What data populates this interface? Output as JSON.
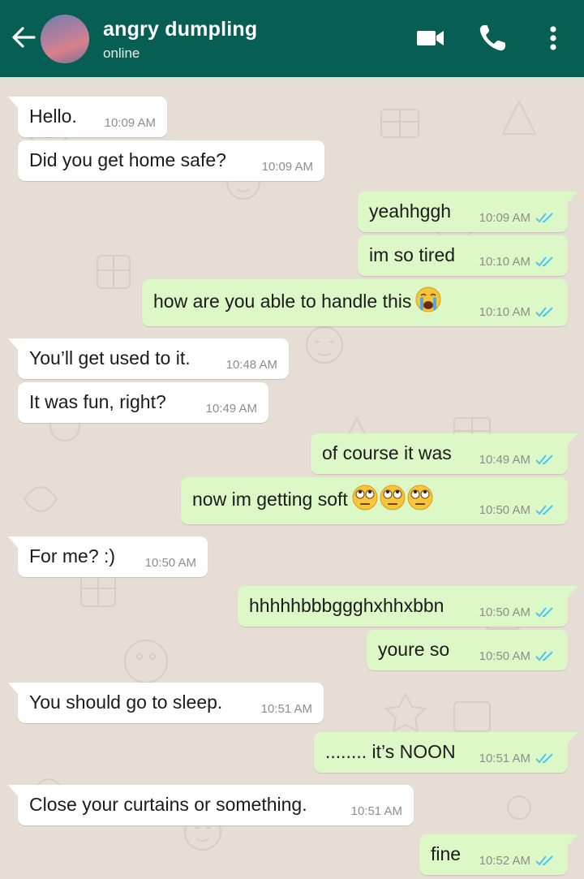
{
  "header": {
    "contact_name": "angry dumpling",
    "status": "online",
    "icons": [
      "back-arrow-icon",
      "avatar",
      "video-call-icon",
      "phone-call-icon",
      "more-options-icon"
    ]
  },
  "colors": {
    "header_bg": "#075e54",
    "chat_bg": "#e6ddd4",
    "incoming_bubble": "#ffffff",
    "outgoing_bubble": "#dcf8c6",
    "read_ticks": "#4fc3f7"
  },
  "messages": [
    {
      "dir": "in",
      "text": "Hello.",
      "time": "10:09 AM"
    },
    {
      "dir": "in",
      "text": "Did you get home safe?",
      "time": "10:09 AM"
    },
    {
      "dir": "out",
      "text": "yeahhggh",
      "time": "10:09 AM",
      "read": true
    },
    {
      "dir": "out",
      "text": "im so tired",
      "time": "10:10 AM",
      "read": true
    },
    {
      "dir": "out",
      "text": "how are you able to handle this",
      "time": "10:10 AM",
      "read": true,
      "emoji": [
        "loudly-crying-face-emoji"
      ]
    },
    {
      "dir": "in",
      "text": "You’ll get used to it.",
      "time": "10:48 AM"
    },
    {
      "dir": "in",
      "text": "It was fun, right?",
      "time": "10:49 AM"
    },
    {
      "dir": "out",
      "text": "of course it was",
      "time": "10:49 AM",
      "read": true
    },
    {
      "dir": "out",
      "text": "now im getting soft",
      "time": "10:50 AM",
      "read": true,
      "emoji": [
        "face-with-rolling-eyes-emoji",
        "face-with-rolling-eyes-emoji",
        "face-with-rolling-eyes-emoji"
      ]
    },
    {
      "dir": "in",
      "text": "For me? :)",
      "time": "10:50 AM"
    },
    {
      "dir": "out",
      "text": "hhhhhbbbggghxhhxbbn",
      "time": "10:50 AM",
      "read": true
    },
    {
      "dir": "out",
      "text": "youre so",
      "time": "10:50 AM",
      "read": true
    },
    {
      "dir": "in",
      "text": "You should go to sleep.",
      "time": "10:51 AM"
    },
    {
      "dir": "out",
      "text": "........ it’s NOON",
      "time": "10:51 AM",
      "read": true
    },
    {
      "dir": "in",
      "text": "Close your curtains or something.",
      "time": "10:51 AM"
    },
    {
      "dir": "out",
      "text": "fine",
      "time": "10:52 AM",
      "read": true
    }
  ]
}
